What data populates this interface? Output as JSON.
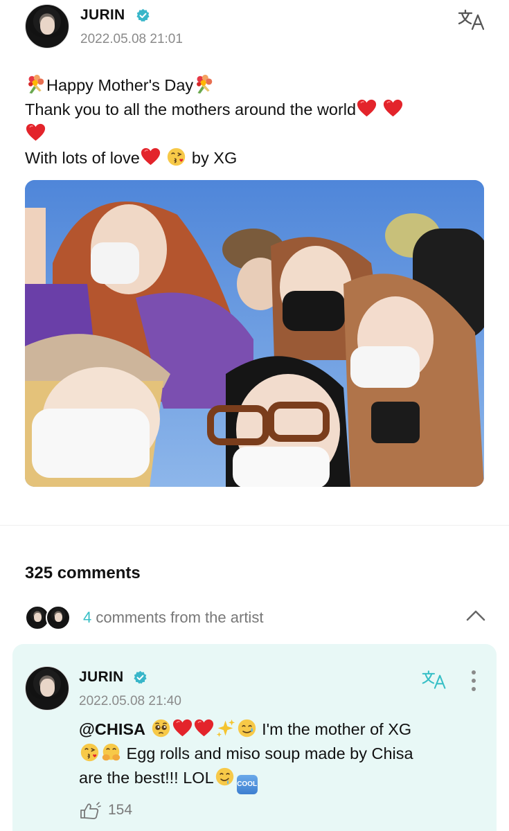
{
  "post": {
    "author": "JURIN",
    "timestamp": "2022.05.08 21:01",
    "lines": {
      "l1_text": "Happy Mother's Day",
      "l2_text": "Thank you to all the mothers around the world",
      "l4_text": "With lots of love",
      "l4_suffix": " by XG"
    },
    "photo_alt": "Group selfie of six members under a blue sky"
  },
  "comments": {
    "count_label": "325 comments",
    "artist_count": "4",
    "artist_label": " comments from the artist"
  },
  "comment": {
    "author": "JURIN",
    "timestamp": "2022.05.08 21:40",
    "mention": "@CHISA",
    "l1_text": " I'm the mother of XG",
    "l2_text": " Egg rolls and miso soup made by Chisa",
    "l3_text": "are the best!!! LOL",
    "cool_badge": "COOL",
    "likes": "154"
  },
  "icons": {
    "verified": "verified-badge-icon",
    "translate": "translate-icon",
    "more": "more-vertical-icon",
    "collapse": "chevron-up-icon",
    "like": "like-hand-icon"
  },
  "colors": {
    "accent": "#37bfc6",
    "verified": "#38b6c9",
    "comment_bg": "#e8f8f6",
    "heart": "#e3242b"
  }
}
